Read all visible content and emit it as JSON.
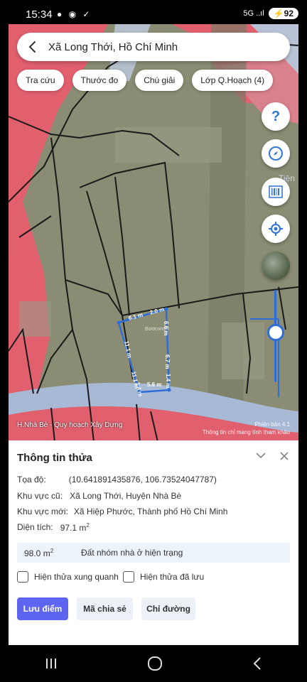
{
  "status_bar": {
    "time": "15:34",
    "icons": "● ◉ ✓",
    "signal": "5G ..ıl",
    "battery": "92"
  },
  "search": {
    "location_text": "Xã Long Thới, Hồ Chí Minh"
  },
  "toolbar_chips": [
    {
      "label": "Tra cứu"
    },
    {
      "label": "Thước đo"
    },
    {
      "label": "Chú giải"
    },
    {
      "label": "Lớp Q.Hoạch (4)"
    }
  ],
  "map_controls": {
    "help_icon": "?",
    "compass_icon": "compass-icon",
    "barcode_icon": "barcode-icon",
    "locate_icon": "crosshair-icon",
    "satellite_icon": "satellite-layer-icon",
    "zoom_level": 0.85
  },
  "map_labels": {
    "footer_left": "H.Nhà Bè - Quy hoạch Xây Dựng",
    "version": "Phiên bản 4.1",
    "disclaimer": "Thông tin chỉ mang tính tham khảo",
    "road_fragment": "Tiện",
    "plot_dims": [
      "6.1 m",
      "2.0 m",
      "6.6 m",
      "11.1 m",
      "6.7 m",
      "1.4 m",
      "11.1 m",
      "1.4 m",
      "5.6 m"
    ],
    "watermark": "Boldcomm"
  },
  "sheet": {
    "title": "Thông tin thửa",
    "rows": {
      "coords_label": "Tọa độ:",
      "coords_value": "(10.641891435876, 106.73524047787)",
      "old_area_label": "Khu vực cũ:",
      "old_area_value": "Xã Long Thới, Huyện Nhà Bè",
      "new_area_label": "Khu vực mới:",
      "new_area_value": "Xã Hiệp Phước, Thành phố Hồ Chí Minh",
      "size_label": "Diện tích:",
      "size_value": "97.1 m",
      "size_unit_sup": "2"
    },
    "plot_summary": {
      "area": "98.0 m",
      "area_sup": "2",
      "type": "Đất nhóm nhà ở hiện trạng"
    },
    "checkboxes": [
      {
        "label": "Hiện thửa xung quanh",
        "checked": false
      },
      {
        "label": "Hiện thửa đã lưu",
        "checked": false
      }
    ],
    "buttons": {
      "save": "Lưu điểm",
      "share": "Mã chia sẻ",
      "directions": "Chỉ đường"
    }
  },
  "colors": {
    "accent": "#5c64f0",
    "map_pink": "#e2606e",
    "map_olive": "#8a8c73",
    "road_blue": "#a8b9d6",
    "plot_outline": "#2f6ed9"
  }
}
